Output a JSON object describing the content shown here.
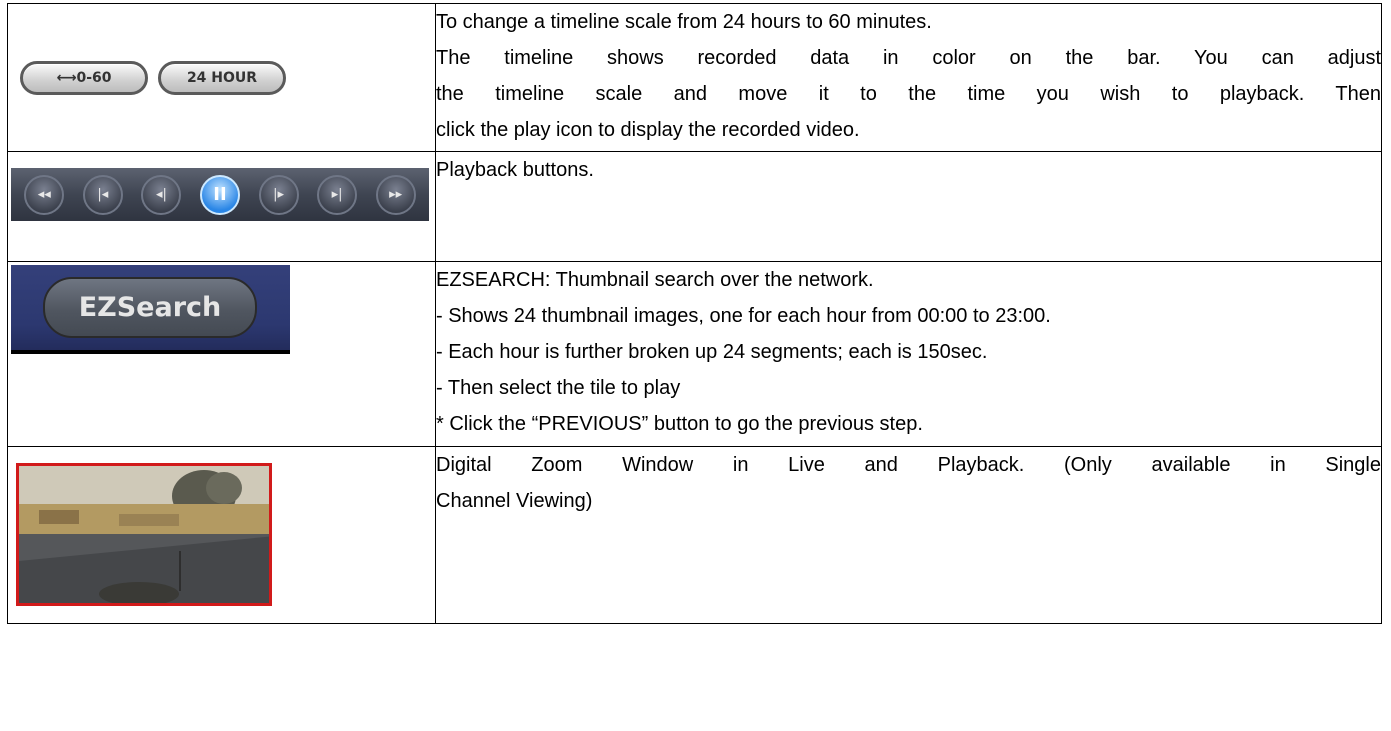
{
  "rows": [
    {
      "buttons": [
        "⟷0-60",
        "24 HOUR"
      ],
      "lines": [
        "To change a timeline scale from 24 hours to 60 minutes.",
        "The timeline shows recorded data in color on the bar. You can adjust",
        "the timeline scale and move it to the time you wish to playback. Then",
        "click the play icon to display the recorded video."
      ]
    },
    {
      "playback_icons": [
        "fast-rewind-icon",
        "step-back-icon",
        "slow-back-icon",
        "pause-icon",
        "slow-forward-icon",
        "step-forward-icon",
        "fast-forward-icon"
      ],
      "playback_glyphs": [
        "◂◂",
        "|◂",
        "◂|",
        "II",
        "|▸",
        "▸|",
        "▸▸"
      ],
      "lines": [
        "Playback buttons."
      ]
    },
    {
      "button": "EZSearch",
      "lines": [
        "EZSEARCH: Thumbnail search over the network.",
        "- Shows 24 thumbnail images, one for each hour from 00:00 to 23:00.",
        "- Each hour is further broken up 24 segments; each is 150sec.",
        "- Then select the tile to play",
        "* Click the “PREVIOUS” button to go the previous step."
      ]
    },
    {
      "lines": [
        "Digital Zoom Window in Live and Playback. (Only available in Single",
        "Channel Viewing)"
      ]
    }
  ],
  "colors": {
    "zoom_border": "#d11a1a",
    "active_button": "#2a86e6",
    "ez_background": "#2c3870"
  }
}
